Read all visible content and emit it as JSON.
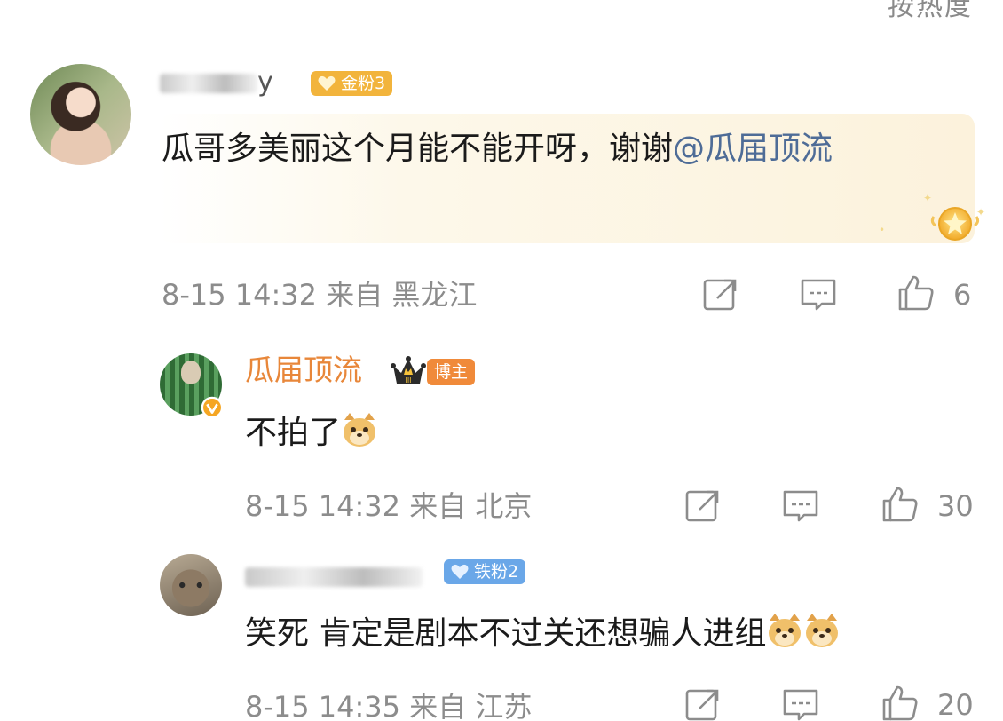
{
  "header": {
    "sort_label": "按热度"
  },
  "comments": [
    {
      "user": {
        "name_visible": "y",
        "badge": "金粉3"
      },
      "text": "瓜哥多美丽这个月能不能开呀，谢谢",
      "mention": "@瓜届顶流",
      "meta": "8-15 14:32 来自 黑龙江",
      "likes": "6"
    },
    {
      "user": {
        "name": "瓜届顶流",
        "badge": "博主"
      },
      "text": "不拍了",
      "meta": "8-15 14:32 来自 北京",
      "likes": "30"
    },
    {
      "user": {
        "badge": "铁粉2"
      },
      "text": "笑死 肯定是剧本不过关还想骗人进组",
      "meta": "8-15 14:35 来自 江苏",
      "likes": "20"
    }
  ],
  "colors": {
    "gold_badge": "#f2b43c",
    "host_badge": "#f08a3a",
    "iron_badge": "#6aa7e8",
    "host_name": "#e8873a",
    "mention": "#4e6c97",
    "meta_gray": "#8c8c8c"
  },
  "icons": [
    "repost-icon",
    "comment-icon",
    "like-icon",
    "crown-icon",
    "verified-icon",
    "gold-star-icon",
    "doge-emoji"
  ]
}
